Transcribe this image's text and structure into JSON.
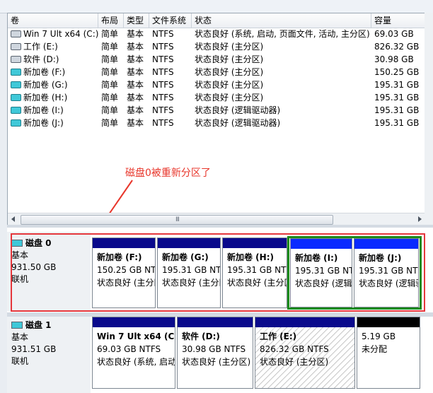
{
  "volume_list": {
    "columns": [
      "卷",
      "布局",
      "类型",
      "文件系统",
      "状态",
      "容量"
    ],
    "rows": [
      {
        "icon": "drive-gray",
        "vol": "Win 7 Ult x64 (C:)",
        "layout": "简单",
        "type": "基本",
        "fs": "NTFS",
        "status": "状态良好 (系统, 启动, 页面文件, 活动, 主分区)",
        "cap": "69.03 GB"
      },
      {
        "icon": "drive-gray",
        "vol": "工作 (E:)",
        "layout": "简单",
        "type": "基本",
        "fs": "NTFS",
        "status": "状态良好 (主分区)",
        "cap": "826.32 GB"
      },
      {
        "icon": "drive-gray",
        "vol": "软件 (D:)",
        "layout": "简单",
        "type": "基本",
        "fs": "NTFS",
        "status": "状态良好 (主分区)",
        "cap": "30.98 GB"
      },
      {
        "icon": "drive-cyan",
        "vol": "新加卷 (F:)",
        "layout": "简单",
        "type": "基本",
        "fs": "NTFS",
        "status": "状态良好 (主分区)",
        "cap": "150.25 GB"
      },
      {
        "icon": "drive-cyan",
        "vol": "新加卷 (G:)",
        "layout": "简单",
        "type": "基本",
        "fs": "NTFS",
        "status": "状态良好 (主分区)",
        "cap": "195.31 GB"
      },
      {
        "icon": "drive-cyan",
        "vol": "新加卷 (H:)",
        "layout": "简单",
        "type": "基本",
        "fs": "NTFS",
        "status": "状态良好 (主分区)",
        "cap": "195.31 GB"
      },
      {
        "icon": "drive-cyan",
        "vol": "新加卷 (I:)",
        "layout": "简单",
        "type": "基本",
        "fs": "NTFS",
        "status": "状态良好 (逻辑驱动器)",
        "cap": "195.31 GB"
      },
      {
        "icon": "drive-cyan",
        "vol": "新加卷 (J:)",
        "layout": "简单",
        "type": "基本",
        "fs": "NTFS",
        "status": "状态良好 (逻辑驱动器)",
        "cap": "195.31 GB"
      }
    ],
    "scroll_grip": "III"
  },
  "annotation": {
    "text": "磁盘0被重新分区了",
    "color": "#e8362b"
  },
  "disks": [
    {
      "name": "磁盘 0",
      "type": "基本",
      "size": "931.50 GB",
      "state": "联机",
      "partitions": [
        {
          "name": "新加卷 (F:)",
          "size": "150.25 GB NTFS",
          "status": "状态良好 (主分区)"
        },
        {
          "name": "新加卷 (G:)",
          "size": "195.31 GB NTFS",
          "status": "状态良好 (主分区)"
        },
        {
          "name": "新加卷 (H:)",
          "size": "195.31 GB NTFS",
          "status": "状态良好 (主分区)"
        },
        {
          "name": "新加卷 (I:)",
          "size": "195.31 GB NTFS",
          "status": "状态良好 (逻辑驱动器)"
        },
        {
          "name": "新加卷 (J:)",
          "size": "195.31 GB NTFS",
          "status": "状态良好 (逻辑驱动器)"
        }
      ]
    },
    {
      "name": "磁盘 1",
      "type": "基本",
      "size": "931.51 GB",
      "state": "联机",
      "partitions": [
        {
          "name": "Win 7 Ult x64 (C:)",
          "size": "69.03 GB NTFS",
          "status": "状态良好 (系统, 启动, 页面文件, 活动, 主分区)"
        },
        {
          "name": "软件 (D:)",
          "size": "30.98 GB NTFS",
          "status": "状态良好 (主分区)"
        },
        {
          "name": "工作 (E:)",
          "size": "826.32 GB NTFS",
          "status": "状态良好 (主分区)"
        },
        {
          "name": "",
          "size": "5.19 GB",
          "status": "未分配"
        }
      ]
    }
  ],
  "colors": {
    "primary_bar": "#0a0a8c",
    "logical_bar": "#0a2aff",
    "unallocated_bar": "#000000",
    "highlight_red": "#e5373c",
    "highlight_green": "#1b8a1b"
  }
}
